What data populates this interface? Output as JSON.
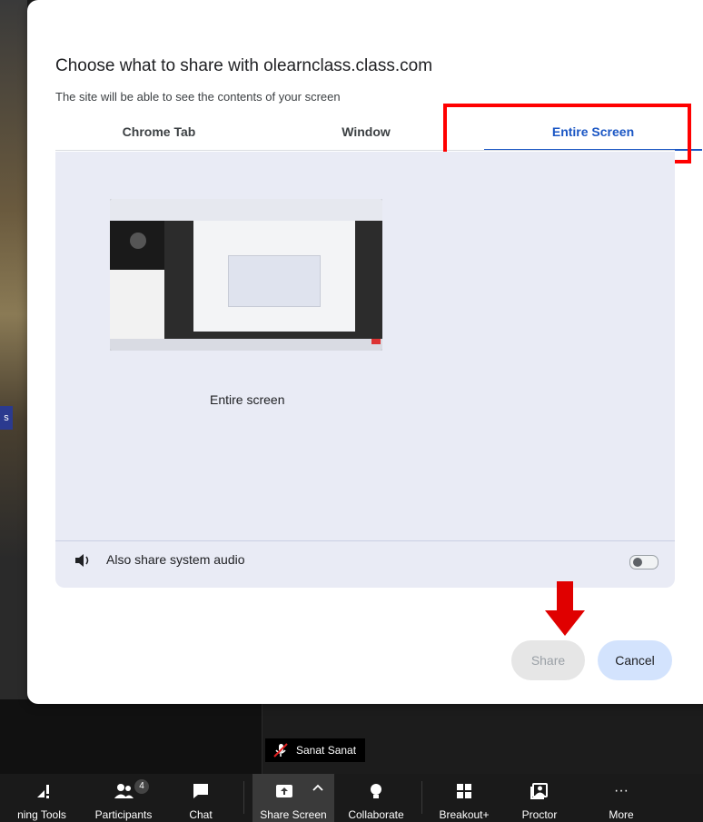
{
  "dialog": {
    "title": "Choose what to share with olearnclass.class.com",
    "subtitle": "The site will be able to see the contents of your screen",
    "tabs": [
      {
        "label": "Chrome Tab",
        "selected": false
      },
      {
        "label": "Window",
        "selected": false
      },
      {
        "label": "Entire Screen",
        "selected": true
      }
    ],
    "source_label": "Entire screen",
    "audio_label": "Also share system audio",
    "audio_enabled": false,
    "share_label": "Share",
    "cancel_label": "Cancel"
  },
  "stage": {
    "participant_name": "Sanat Sanat",
    "left_tag": "s"
  },
  "toolbar": {
    "items": [
      {
        "label": "ning Tools",
        "icon": "tools-icon"
      },
      {
        "label": "Participants",
        "icon": "participants-icon",
        "badge": "4"
      },
      {
        "label": "Chat",
        "icon": "chat-icon"
      },
      {
        "label": "Share Screen",
        "icon": "share-screen-icon"
      },
      {
        "label": "Collaborate",
        "icon": "lightbulb-icon"
      },
      {
        "label": "Breakout+",
        "icon": "grid-icon"
      },
      {
        "label": "Proctor",
        "icon": "proctor-icon"
      },
      {
        "label": "More",
        "icon": "more-icon",
        "glyph": "···"
      }
    ]
  },
  "colors": {
    "accent": "#1a56c4",
    "highlight_box": "#ff0000",
    "arrow": "#e00000",
    "panel": "#e9ebf5",
    "cancel_bg": "#d3e3fd"
  }
}
